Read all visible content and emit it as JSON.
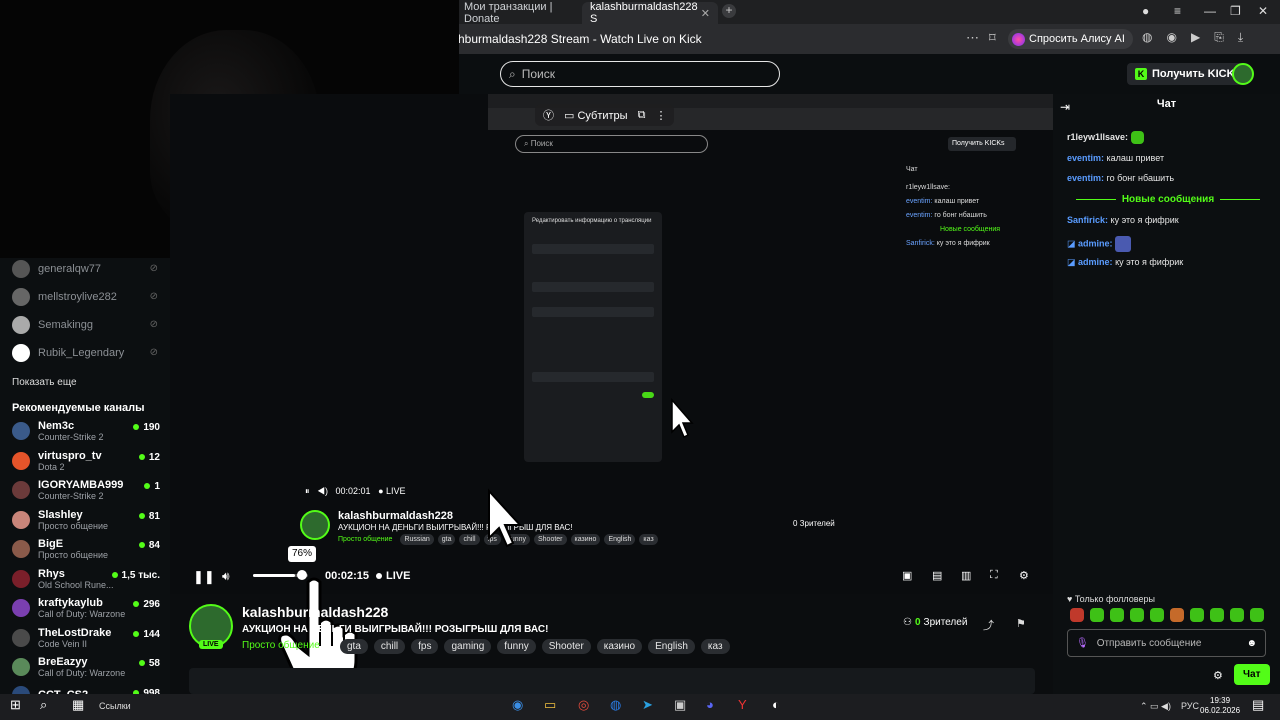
{
  "browser": {
    "tabs": [
      {
        "label": "Мои транзакции | Donate"
      },
      {
        "label": "kalashburmaldash228 S"
      }
    ],
    "page_title": "hburmaldash228 Stream - Watch Live on Kick",
    "alice_label": "Спросить Алису AI"
  },
  "kick": {
    "search_placeholder": "Поиск",
    "get_kicks_label": "Получить KICKs"
  },
  "sidebar": {
    "followed": [
      {
        "name": "generalqw77"
      },
      {
        "name": "mellstroylive282"
      },
      {
        "name": "Semakingg"
      },
      {
        "name": "Rubik_Legendary"
      }
    ],
    "show_more": "Показать еще",
    "recommended_header": "Рекомендуемые каналы",
    "recommended": [
      {
        "name": "Nem3c",
        "category": "Counter-Strike 2",
        "viewers": "190",
        "color": "#3a5a8a"
      },
      {
        "name": "virtuspro_tv",
        "category": "Dota 2",
        "viewers": "12",
        "color": "#e5542a"
      },
      {
        "name": "IGORYAMBA999",
        "category": "Counter-Strike 2",
        "viewers": "1",
        "color": "#6b3a3a"
      },
      {
        "name": "Slashley",
        "category": "Просто общение",
        "viewers": "81",
        "color": "#c9857a"
      },
      {
        "name": "BigE",
        "category": "Просто общение",
        "viewers": "84",
        "color": "#8a5a4a"
      },
      {
        "name": "Rhys",
        "category": "Old School Rune...",
        "viewers": "1,5 тыс.",
        "color": "#7a1f2a"
      },
      {
        "name": "kraftykaylub",
        "category": "Call of Duty: Warzone",
        "viewers": "296",
        "color": "#7a3fb0"
      },
      {
        "name": "TheLostDrake",
        "category": "Code Vein II",
        "viewers": "144",
        "color": "#4a4a4a"
      },
      {
        "name": "BreEazyy",
        "category": "Call of Duty: Warzone",
        "viewers": "58",
        "color": "#5a8a5a"
      },
      {
        "name": "CCT_CS2",
        "category": "",
        "viewers": "998",
        "color": "#2a4a7a"
      }
    ]
  },
  "nested": {
    "subtitles_label": "Субтитры",
    "time": "00:02:01",
    "live": "LIVE",
    "streamer": "kalashburmaldash228",
    "title": "АУКЦИОН НА ДЕНЬГИ ВЫИГРЫВАЙ!!! РОЗЫГРЫШ ДЛЯ ВАС!",
    "category": "Просто общение",
    "tags": [
      "Russian",
      "gta",
      "chill",
      "fps",
      "funny",
      "Shooter",
      "казино",
      "English",
      "каз"
    ],
    "viewers": "0 Зрителей",
    "dialog_title": "Редактировать информацию о трансляции"
  },
  "player": {
    "time": "00:02:15",
    "live": "LIVE",
    "volume_tooltip": "76%",
    "volume": 0.76
  },
  "stream": {
    "streamer": "kalashburmaldash228",
    "title": "АУКЦИОН НА ДЕНЬГИ ВЫИГРЫВАЙ!!! РОЗЫГРЫШ ДЛЯ ВАС!",
    "category": "Просто общение",
    "tags": [
      "Russian",
      "gta",
      "chill",
      "fps",
      "gaming",
      "funny",
      "Shooter",
      "казино",
      "English",
      "каз"
    ],
    "live_badge": "LIVE",
    "viewers_count": "0",
    "viewers_label": "Зрителей"
  },
  "chat": {
    "title": "Чат",
    "messages": [
      {
        "user": "r1leyw1llsave:",
        "text": "",
        "color": "#ffffff"
      },
      {
        "user": "eventim:",
        "text": "калаш привет",
        "color": "#5a9cff"
      },
      {
        "user": "eventim:",
        "text": "го бонг нбашить",
        "color": "#5a9cff"
      },
      {
        "user": "Sanfirick:",
        "text": "ку это я фифрик",
        "color": "#5a9cff"
      },
      {
        "user": "admine:",
        "text": "",
        "color": "#5a9cff"
      },
      {
        "user": "admine:",
        "text": "ку это я фифрик",
        "color": "#5a9cff"
      }
    ],
    "new_messages_label": "Новые сообщения",
    "followers_label": "Только фолловеры",
    "input_placeholder": "Отправить сообщение",
    "send_label": "Чат"
  },
  "taskbar": {
    "links_label": "Ссылки",
    "lang": "РУС",
    "time": "19:39",
    "date": "06.02.2026"
  }
}
